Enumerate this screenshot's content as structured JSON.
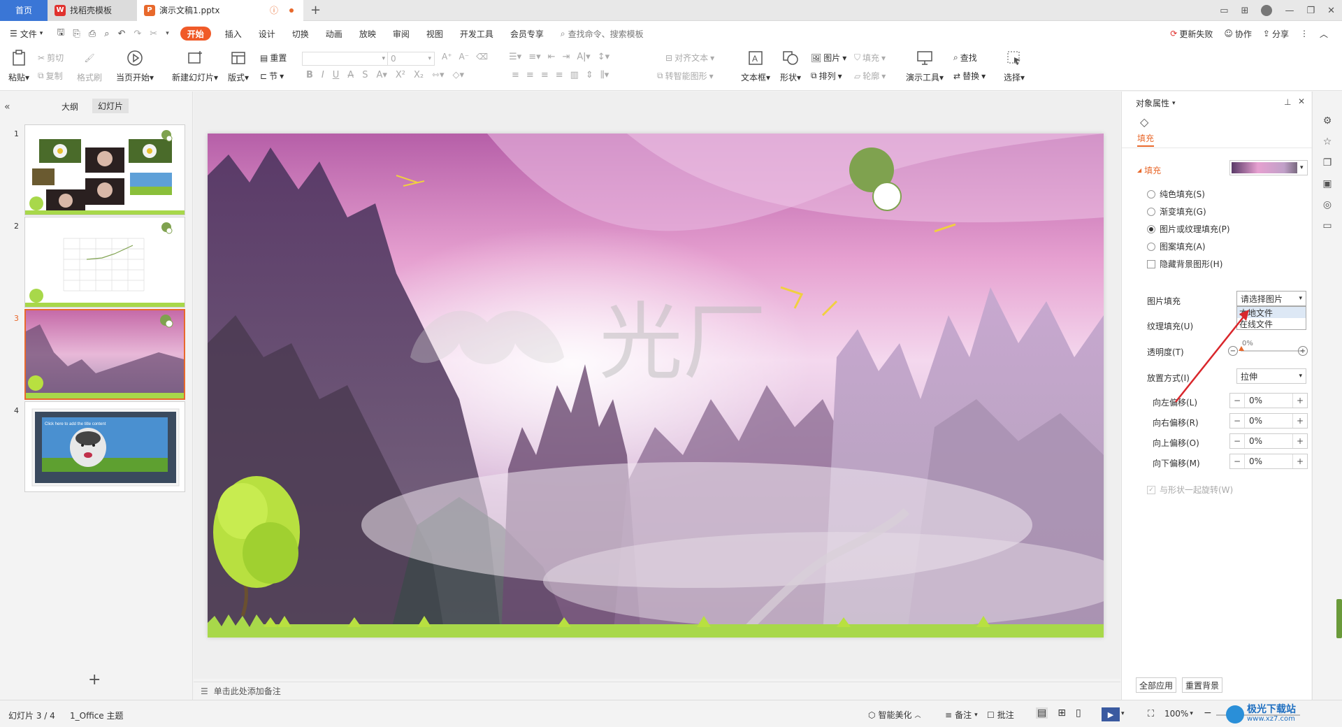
{
  "titlebar": {
    "home_tab": "首页",
    "template_tab": "找稻壳模板",
    "doc_tab": "演示文稿1.pptx"
  },
  "menubar": {
    "file": "文件",
    "items": [
      "开始",
      "插入",
      "设计",
      "切换",
      "动画",
      "放映",
      "审阅",
      "视图",
      "开发工具",
      "会员专享"
    ],
    "search_placeholder": "查找命令、搜索模板",
    "update_failed": "更新失败",
    "collaborate": "协作",
    "share": "分享"
  },
  "ribbon": {
    "paste": "粘贴",
    "cut": "剪切",
    "copy": "复制",
    "format_painter": "格式刷",
    "play_from_current": "当页开始",
    "new_slide": "新建幻灯片",
    "layout": "版式",
    "reset": "重置",
    "section": "节",
    "font_size": "0",
    "align_text": "对齐文本",
    "convert_smartart": "转智能图形",
    "textbox": "文本框",
    "shape": "形状",
    "picture": "图片",
    "arrange": "排列",
    "fill": "填充",
    "outline": "轮廓",
    "presentation_tools": "演示工具",
    "find": "查找",
    "replace": "替换",
    "select": "选择"
  },
  "leftpanel": {
    "tab_outline": "大纲",
    "tab_slides": "幻灯片",
    "slide_numbers": [
      "1",
      "2",
      "3",
      "4"
    ],
    "slide4_text": "Click here to add the title content"
  },
  "slide": {
    "watermark": "光厂"
  },
  "notes": {
    "placeholder": "单击此处添加备注"
  },
  "rightpanel": {
    "title": "对象属性",
    "tab_fill": "填充",
    "section_fill": "填充",
    "options": [
      {
        "label": "纯色填充(S)",
        "selected": false
      },
      {
        "label": "渐变填充(G)",
        "selected": false
      },
      {
        "label": "图片或纹理填充(P)",
        "selected": true
      },
      {
        "label": "图案填充(A)",
        "selected": false
      }
    ],
    "hide_bg": "隐藏背景图形(H)",
    "picture_fill_label": "图片填充",
    "picture_fill_value": "请选择图片",
    "dropdown_items": [
      "本地文件",
      "在线文件"
    ],
    "texture_fill_label": "纹理填充(U)",
    "transparency_label": "透明度(T)",
    "transparency_value": "0%",
    "placement_label": "放置方式(I)",
    "placement_value": "拉伸",
    "offsets": [
      {
        "label": "向左偏移(L)",
        "value": "0%"
      },
      {
        "label": "向右偏移(R)",
        "value": "0%"
      },
      {
        "label": "向上偏移(O)",
        "value": "0%"
      },
      {
        "label": "向下偏移(M)",
        "value": "0%"
      }
    ],
    "rotate_with_shape": "与形状一起旋转(W)",
    "apply_all": "全部应用",
    "reset_bg": "重置背景"
  },
  "statusbar": {
    "slide_info": "幻灯片 3 / 4",
    "theme": "1_Office 主题",
    "smart_beautify": "智能美化",
    "notes": "备注",
    "comments": "批注",
    "zoom": "100%",
    "watermark_site": "极光下载站",
    "watermark_url": "www.xz7.com"
  },
  "colors": {
    "accent": "#f05a28",
    "home_tab": "#3a76d6",
    "selected_border": "#e8692c",
    "arrow": "#d9262b",
    "green_circle": "#7fa24f"
  }
}
